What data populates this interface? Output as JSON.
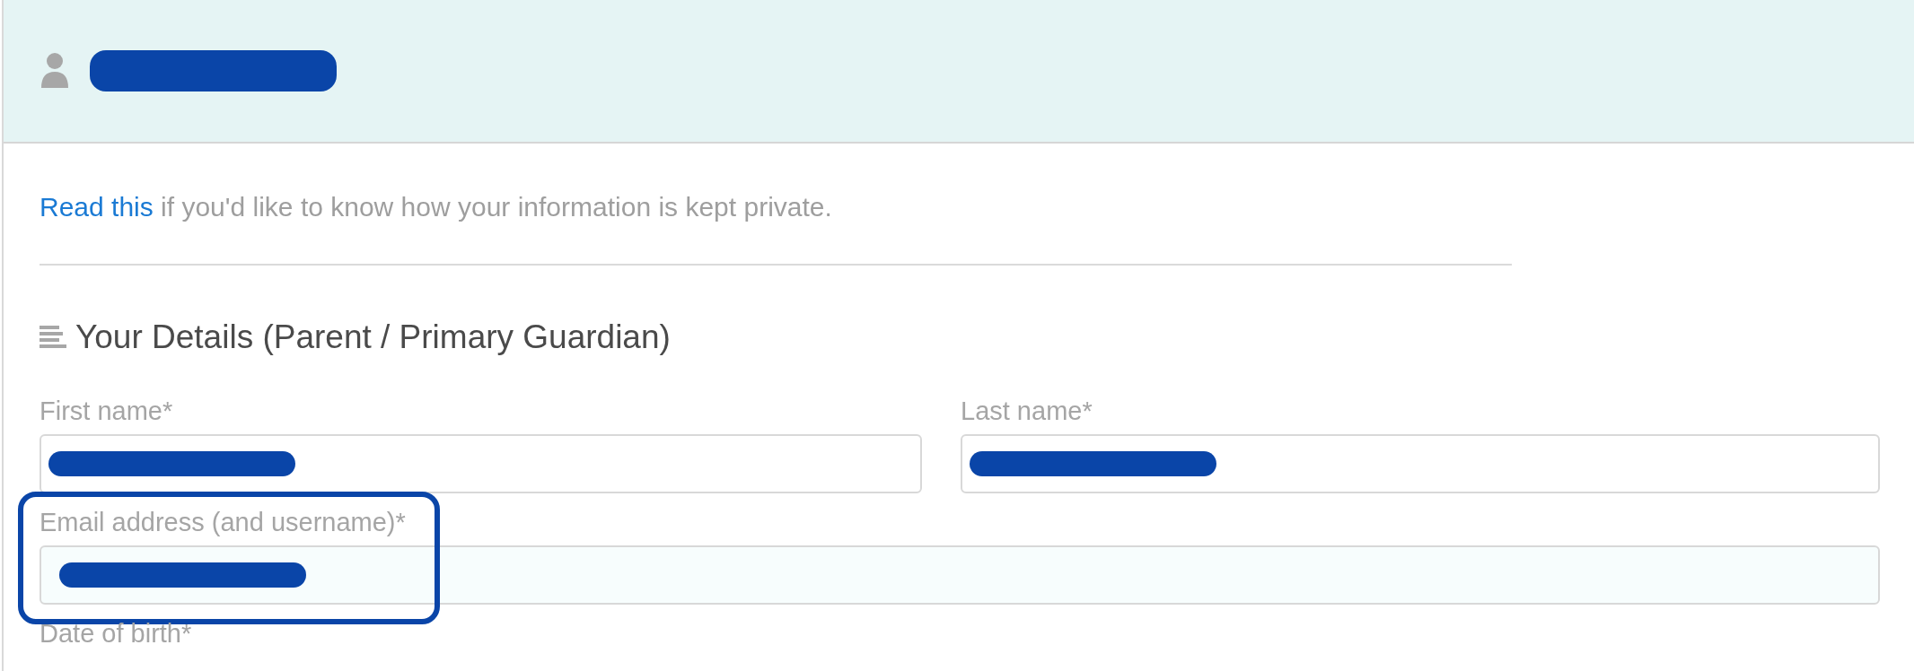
{
  "header": {
    "title_redacted": true
  },
  "privacy_note": {
    "link": "Read this",
    "text": "if you'd like to know how your information is kept private."
  },
  "section": {
    "title": "Your Details (Parent / Primary Guardian)"
  },
  "field_rows": [
    [
      {
        "label": "First name*",
        "redacted": true,
        "highlighted": false
      },
      {
        "label": "Last name*",
        "redacted": true,
        "highlighted": false
      }
    ],
    [
      {
        "label": "Email address (and username)*",
        "redacted": true,
        "highlighted": true
      }
    ],
    [
      {
        "label": "Date of birth*",
        "highlighted": false
      }
    ]
  ]
}
